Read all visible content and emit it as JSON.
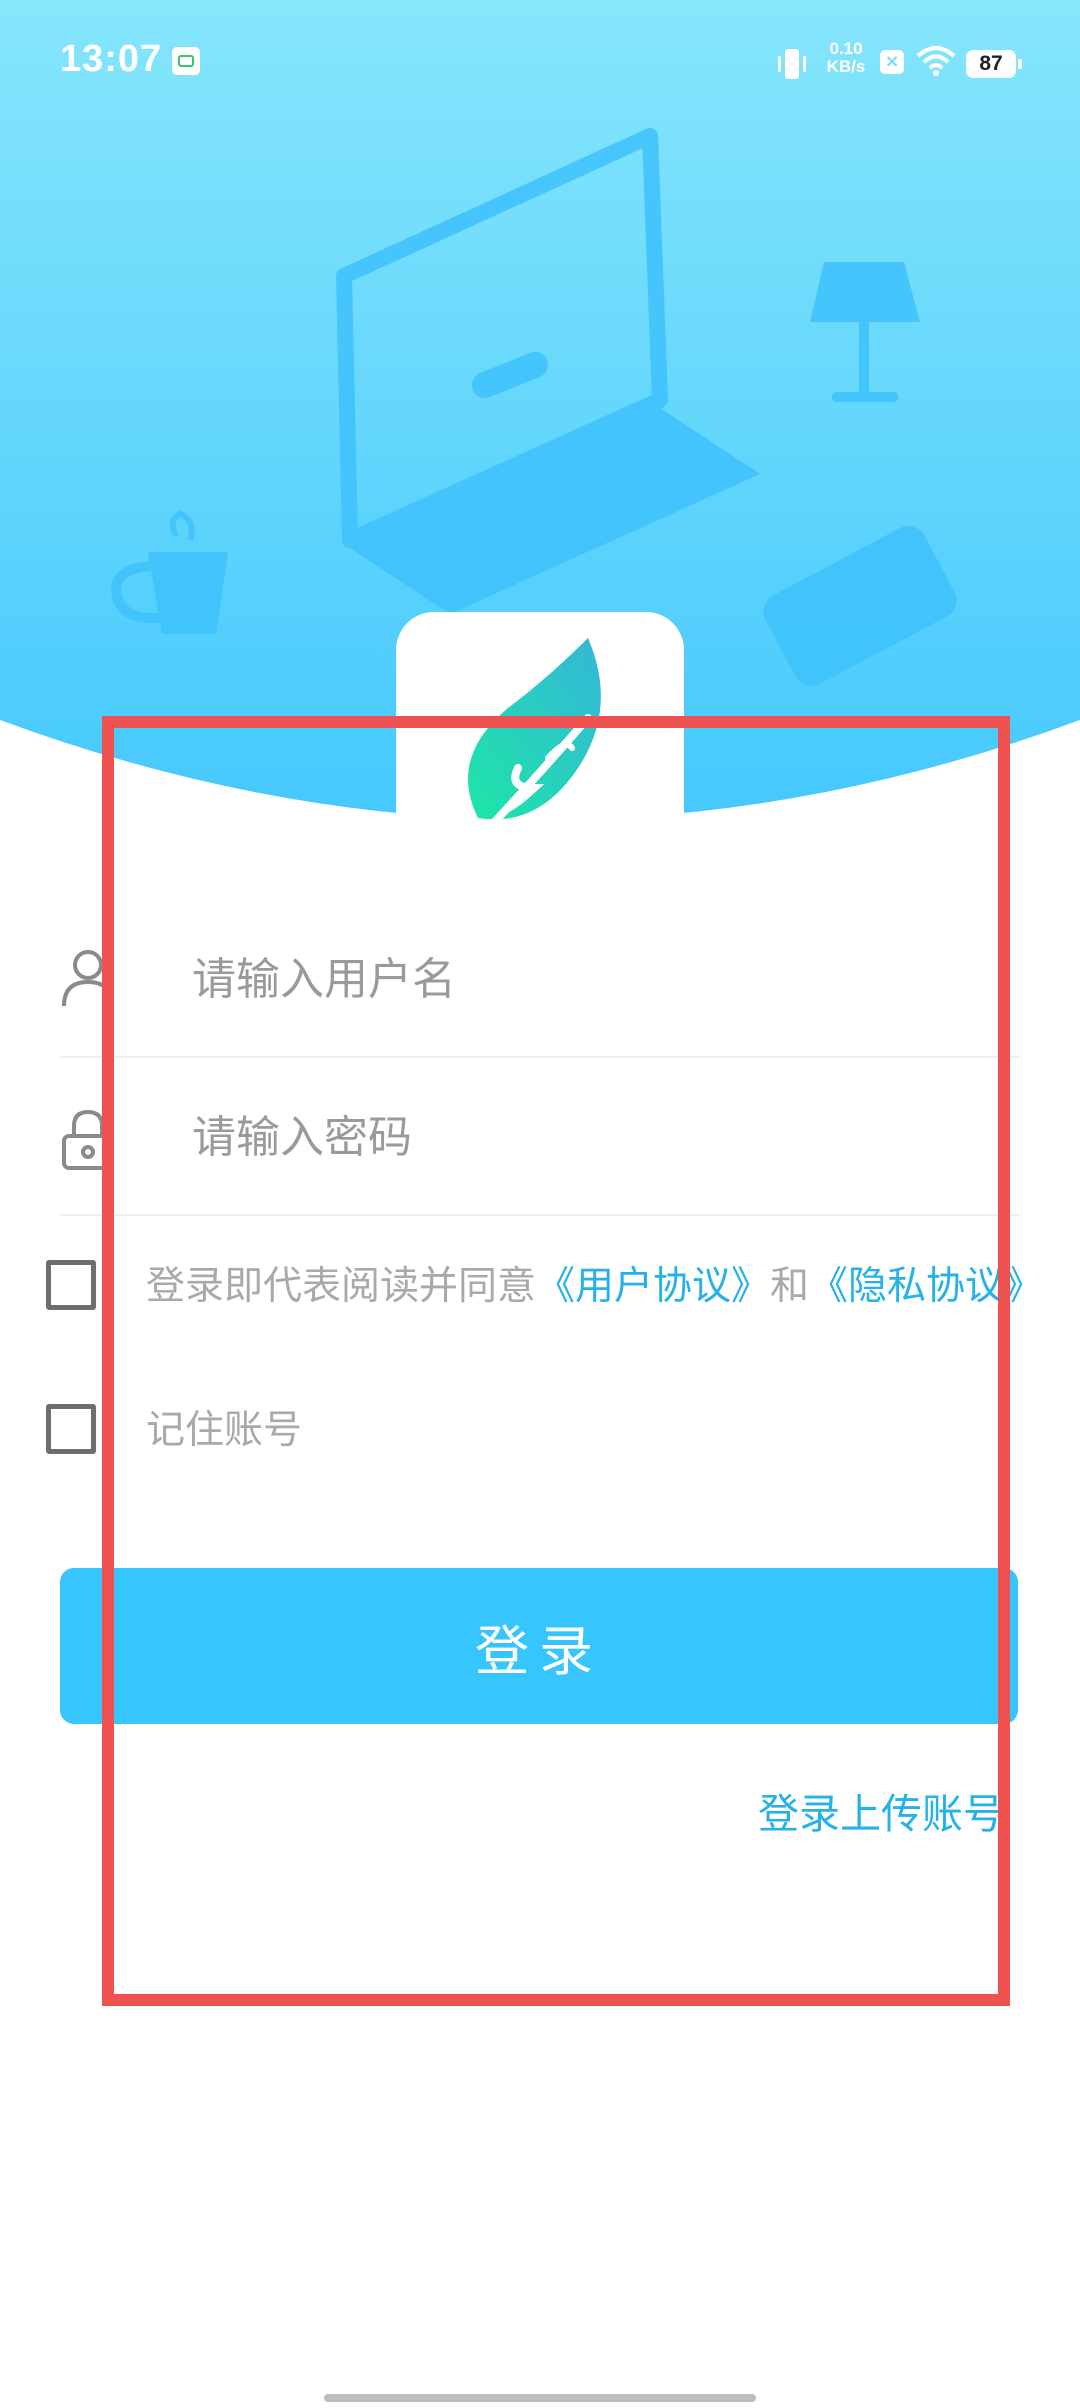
{
  "status_bar": {
    "time": "13:07",
    "network_speed_value": "0.10",
    "network_speed_unit": "KB/s",
    "battery": "87",
    "icons": [
      "app-notification-icon",
      "vibrate-icon",
      "sim-x-icon",
      "wifi-icon",
      "battery-icon"
    ]
  },
  "form": {
    "username_placeholder": "请输入用户名",
    "password_placeholder": "请输入密码",
    "agreement_prefix": "登录即代表阅读并同意",
    "user_agreement_link": "《用户协议》",
    "agreement_and": "和",
    "privacy_link": "《隐私协议》",
    "remember_label": "记住账号",
    "login_button": "登录",
    "upload_account_link": "登录上传账号"
  },
  "colors": {
    "accent": "#36c6fd",
    "link": "#27b1e9",
    "header_gradient_top": "#86e6fc",
    "header_gradient_bottom": "#45c8fd",
    "highlight": "#ef5050"
  }
}
